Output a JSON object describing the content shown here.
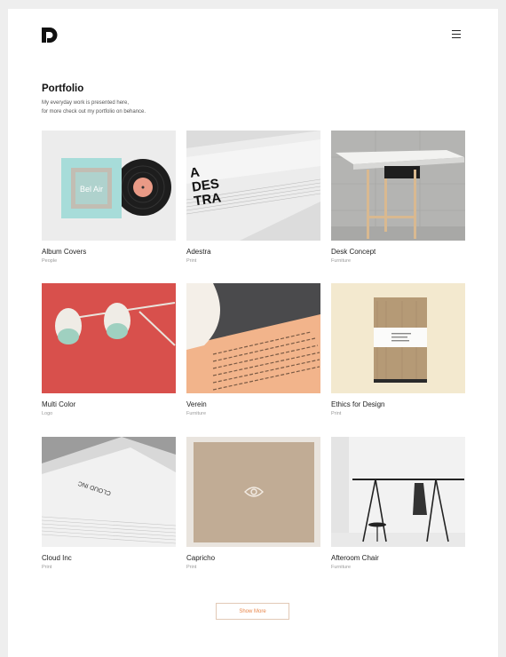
{
  "header": {
    "logo_icon": "d-monogram-logo",
    "menu_icon": "hamburger-menu-icon"
  },
  "portfolio": {
    "title": "Portfolio",
    "intro_line1": "My everyday work is presented here,",
    "intro_line2": "for more check out my portfolio on behance.",
    "items": [
      {
        "title": "Album Covers",
        "category": "People",
        "thumb_text": "Bel Air"
      },
      {
        "title": "Adestra",
        "category": "Print",
        "thumb_text_1": "A",
        "thumb_text_2": "DES",
        "thumb_text_3": "TRA"
      },
      {
        "title": "Desk Concept",
        "category": "Furniture"
      },
      {
        "title": "Multi Color",
        "category": "Logo"
      },
      {
        "title": "Verein",
        "category": "Furniture"
      },
      {
        "title": "Ethics for Design",
        "category": "Print"
      },
      {
        "title": "Cloud Inc",
        "category": "Print",
        "thumb_text": "CLOUD INC"
      },
      {
        "title": "Capricho",
        "category": "Print",
        "thumb_icon": "eye-icon"
      },
      {
        "title": "Afteroom Chair",
        "category": "Furniture"
      }
    ],
    "show_more_label": "Show More"
  },
  "colors": {
    "accent": "#e8864a",
    "background": "#eeeeee",
    "card_bg": "#ffffff"
  }
}
